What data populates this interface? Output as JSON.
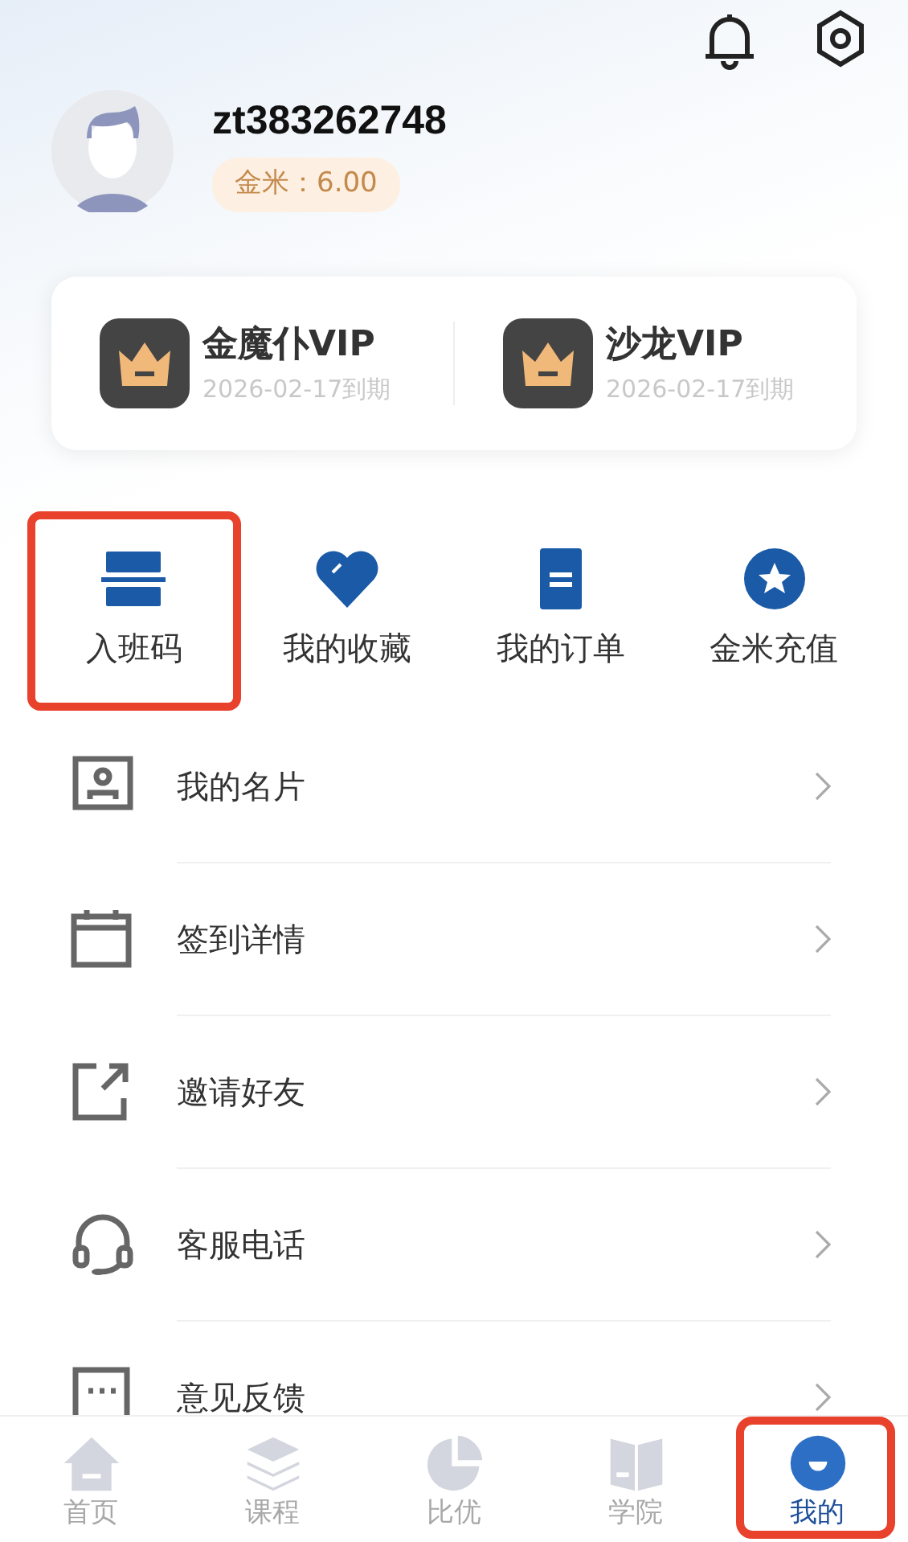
{
  "profile": {
    "username": "zt383262748",
    "balance": "金米：6.00"
  },
  "memberships": [
    {
      "name": "金魔仆VIP",
      "expiry": "2026-02-17到期"
    },
    {
      "name": "沙龙VIP",
      "expiry": "2026-02-17到期"
    }
  ],
  "quick_actions": [
    {
      "kind": "class-code",
      "label": "入班码",
      "highlighted": true
    },
    {
      "kind": "favorites",
      "label": "我的收藏",
      "highlighted": false
    },
    {
      "kind": "orders",
      "label": "我的订单",
      "highlighted": false
    },
    {
      "kind": "recharge",
      "label": "金米充值",
      "highlighted": false
    }
  ],
  "menu": [
    {
      "kind": "card",
      "label": "我的名片"
    },
    {
      "kind": "calendar",
      "label": "签到详情"
    },
    {
      "kind": "share",
      "label": "邀请好友"
    },
    {
      "kind": "headset",
      "label": "客服电话"
    },
    {
      "kind": "feedback",
      "label": "意见反馈"
    }
  ],
  "tab_bar": [
    {
      "kind": "home",
      "label": "首页",
      "selected": false,
      "highlighted": false
    },
    {
      "kind": "courses",
      "label": "课程",
      "selected": false,
      "highlighted": false
    },
    {
      "kind": "compare",
      "label": "比优",
      "selected": false,
      "highlighted": false
    },
    {
      "kind": "academy",
      "label": "学院",
      "selected": false,
      "highlighted": false
    },
    {
      "kind": "me",
      "label": "我的",
      "selected": true,
      "highlighted": true
    }
  ]
}
